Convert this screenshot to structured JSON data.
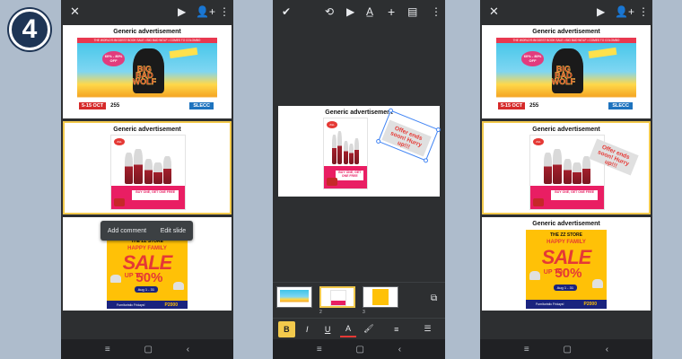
{
  "step_number": "4",
  "slide_title": "Generic advertisement",
  "context_menu": {
    "add_comment": "Add comment",
    "edit_slide": "Edit slide"
  },
  "bbw": {
    "banner": "THE WORLD'S BIGGEST BOOK SALE • BIG BAD WOLF • COMES TO COLOMBO",
    "discount": "60% - 80% OFF",
    "title": "BIG BAD WOLF",
    "date": "5-15 OCT",
    "hours": "255",
    "venue": "SLECC"
  },
  "fam": {
    "logo": "Z&L",
    "band_text": "BUY ONE, GET ONE FREE"
  },
  "sale": {
    "store": "THE ZZ STORE",
    "happy": "HAPPY FAMILY",
    "big": "SALE",
    "upto": "UP TO",
    "pct": "50%",
    "date": "Aug 1 - 31",
    "foot_left": "Furnituristic Fridays!",
    "foot_price": "P2000"
  },
  "sticker_text": "Offer ends soon! Hurry up!!!",
  "thumb_numbers": [
    "1",
    "2",
    "3"
  ],
  "format_bar": {
    "bold": "B",
    "italic": "I",
    "underline": "U",
    "color": "A",
    "highlight": "🖌",
    "align": "≡",
    "list": "☰"
  },
  "nav": {
    "recents": "≡",
    "home": "▢",
    "back": "‹"
  },
  "colors": {
    "accent_selected": "#f2c94c",
    "selection_blue": "#4285f4",
    "background": "#aebccc"
  }
}
